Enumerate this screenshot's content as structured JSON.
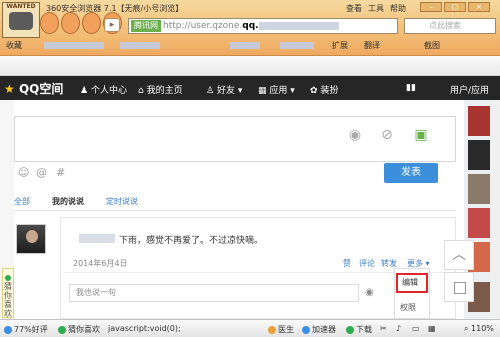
{
  "browser": {
    "logo_text": "WANTED",
    "title": "360安全浏览器 7.1【无痕/小号浏览】",
    "menu": [
      "查看",
      "工具",
      "帮助"
    ],
    "site_label": "腾讯网",
    "url_prefix": "http://user.qzone.",
    "url_bold": "qq.",
    "search_placeholder": "点此搜索",
    "fav_label": "收藏",
    "ext_label": "扩展",
    "ext2_label": "翻译",
    "ext3_label": "截图",
    "back_icon": "back-arrow",
    "forward_icon": "forward-arrow"
  },
  "qqbar": {
    "logo": "QQ空间",
    "items": [
      "个人中心",
      "我的主页",
      "好友",
      "应用",
      "装扮"
    ],
    "right_item": "用户/应用"
  },
  "composer": {
    "post_label": "发表"
  },
  "tabs": {
    "all": "全部",
    "mine": "我的说说",
    "timed": "定时说说"
  },
  "post": {
    "text": "下雨，感觉不再爱了。不过凉快嘀。",
    "date": "2014年6月4日",
    "actions": [
      "赞",
      "评论",
      "转发",
      "更多"
    ],
    "comment_placeholder": "我也说一句",
    "menu_edit": "编辑",
    "menu_permit": "权限"
  },
  "sidebar": {
    "guess_label": "猜你喜欢"
  },
  "status": {
    "rating": "77%好评",
    "guess": "猜你喜欢",
    "js_status": "javascript:void(0);",
    "doctor": "医生",
    "accelerator": "加速器",
    "download": "下载",
    "zoom": "110%"
  },
  "colors": {
    "qq_bar": "#262626",
    "post_button": "#3b8fdb",
    "highlight": "#e0262b",
    "browser_frame": "#f3c27a"
  }
}
